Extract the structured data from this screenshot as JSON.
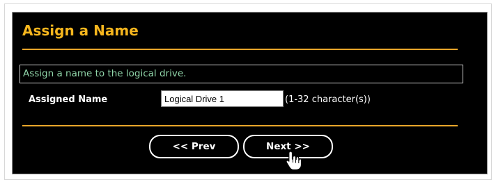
{
  "dialog": {
    "title": "Assign a Name",
    "info_text": "Assign a name to the logical drive."
  },
  "form": {
    "assigned_name_label": "Assigned Name",
    "assigned_name_value": "Logical Drive 1",
    "assigned_name_hint": "(1-32 character(s))"
  },
  "buttons": {
    "prev_label": "<< Prev",
    "next_label": "Next >>"
  },
  "cursor": {
    "icon": "hand-pointer-icon"
  },
  "colors": {
    "panel_background": "#000000",
    "title": "#f6b61e",
    "rule": "#e8a62a",
    "info_text": "#8fd4a8",
    "text": "#ffffff"
  }
}
